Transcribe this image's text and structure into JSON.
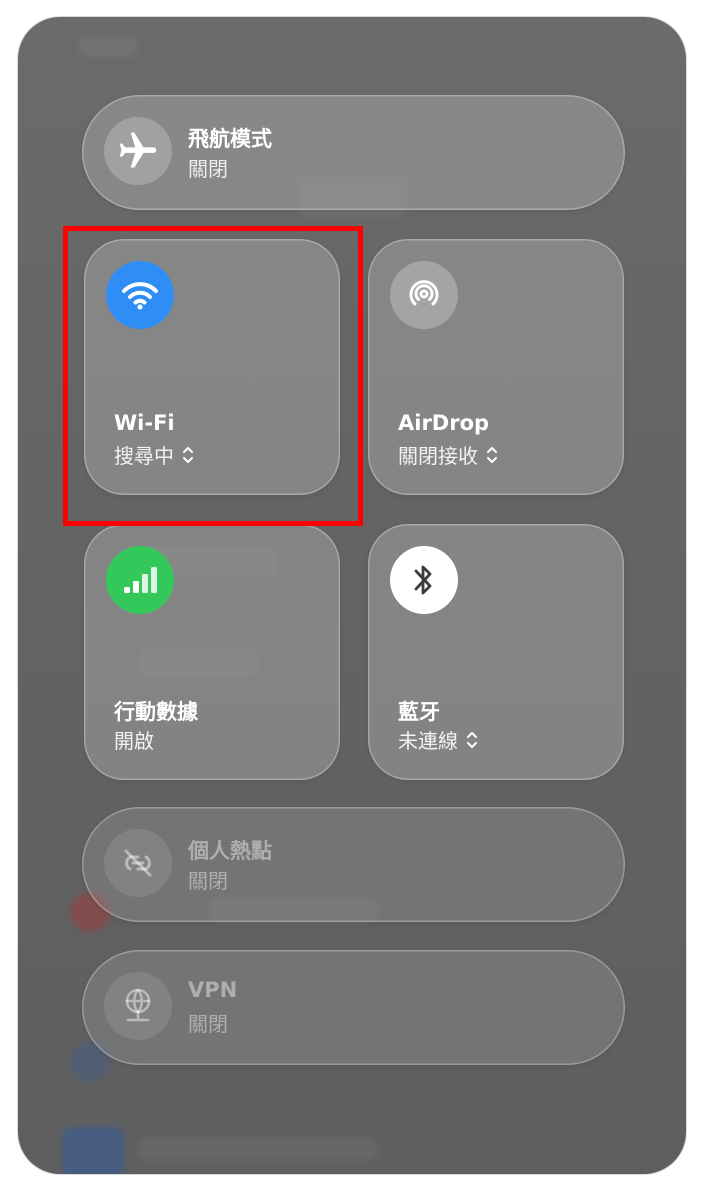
{
  "airplane": {
    "title": "飛航模式",
    "status": "關閉"
  },
  "wifi": {
    "title": "Wi-Fi",
    "status": "搜尋中",
    "accent": "#2f8ef5"
  },
  "airdrop": {
    "title": "AirDrop",
    "status": "關閉接收"
  },
  "cellular": {
    "title": "行動數據",
    "status": "開啟",
    "accent": "#34c759"
  },
  "bluetooth": {
    "title": "藍牙",
    "status": "未連線"
  },
  "hotspot": {
    "title": "個人熱點",
    "status": "關閉"
  },
  "vpn": {
    "title": "VPN",
    "status": "關閉"
  },
  "icons": [
    "airplane-icon",
    "wifi-icon",
    "airdrop-icon",
    "cellular-icon",
    "bluetooth-icon",
    "hotspot-icon",
    "vpn-icon",
    "chevron-updown-icon"
  ],
  "colors": {
    "highlight": "#ff0000",
    "tile": "#a9a9a9",
    "background": "#666666"
  }
}
